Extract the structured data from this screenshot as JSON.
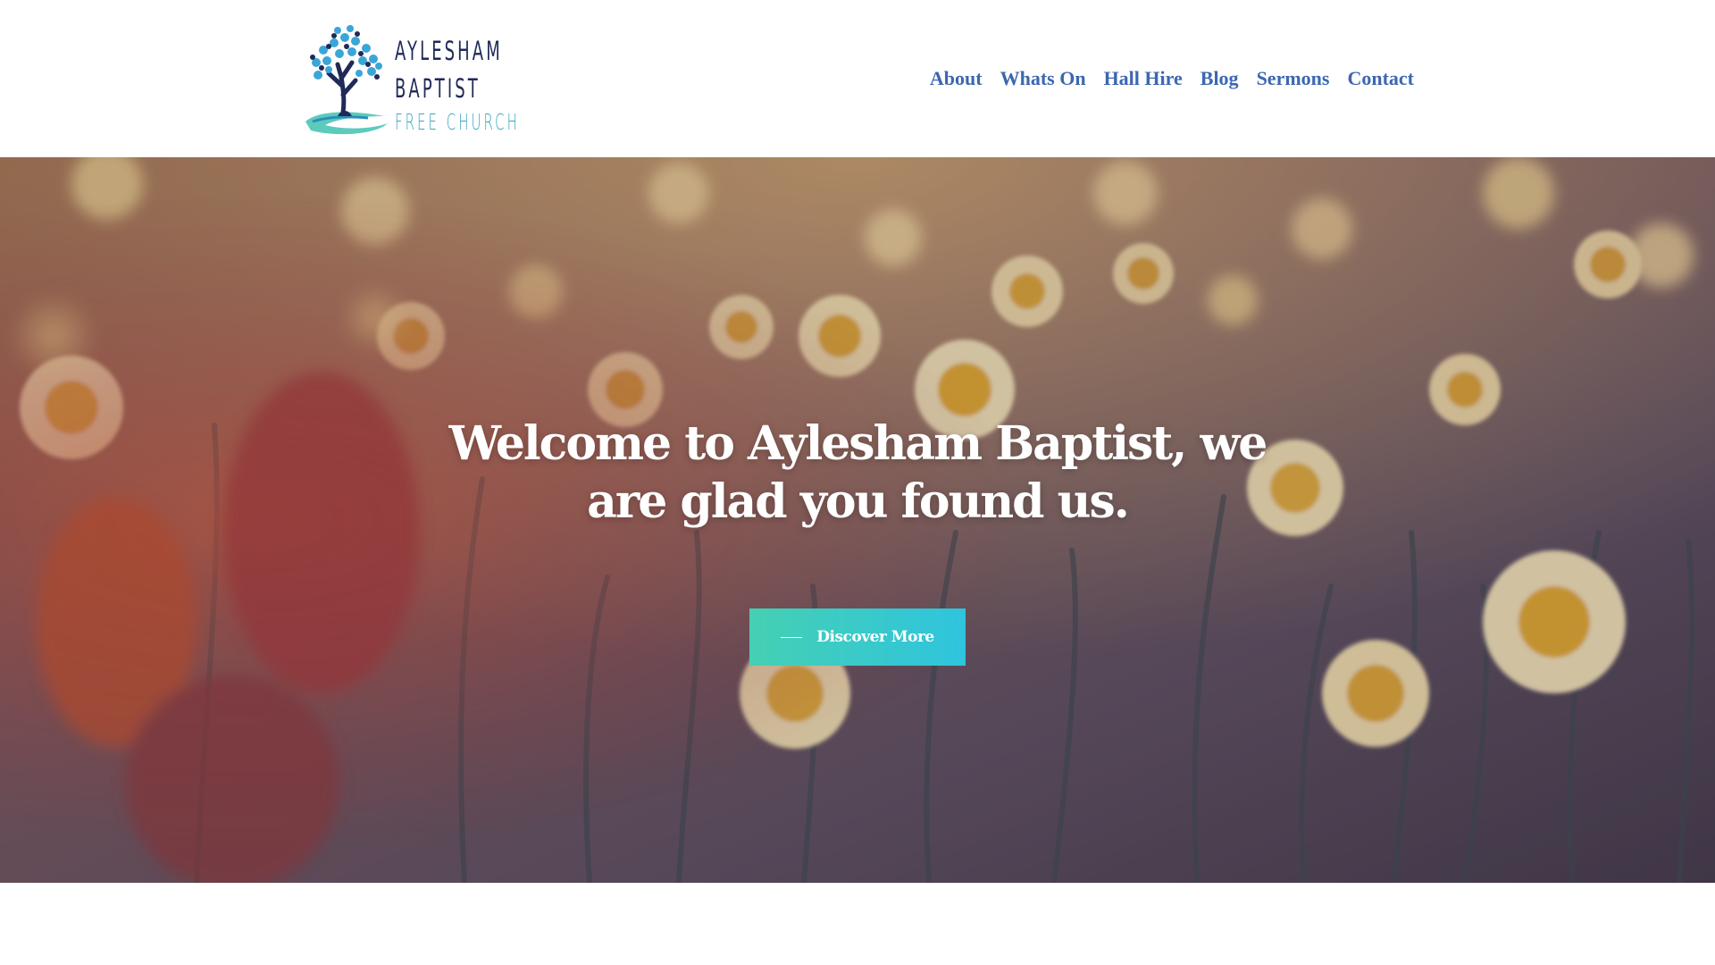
{
  "header": {
    "logo": {
      "line1": "AYLESHAM",
      "line2": "BAPTIST",
      "line3": "FREE CHURCH",
      "colors": {
        "text": "#1f2a58",
        "tree_leaves": "#3aa6d8",
        "water": "#3fc2b0"
      }
    },
    "nav": [
      {
        "label": "About"
      },
      {
        "label": "Whats On"
      },
      {
        "label": "Hall Hire"
      },
      {
        "label": "Blog"
      },
      {
        "label": "Sermons"
      },
      {
        "label": "Contact"
      }
    ],
    "nav_color": "#3c67b0"
  },
  "hero": {
    "title": "Welcome to Aylesham Baptist, we are glad you found us.",
    "button_label": "Discover More",
    "button_gradient": [
      "#45d0b3",
      "#2fc4de"
    ],
    "background_image": "daffodil-field-photo"
  }
}
